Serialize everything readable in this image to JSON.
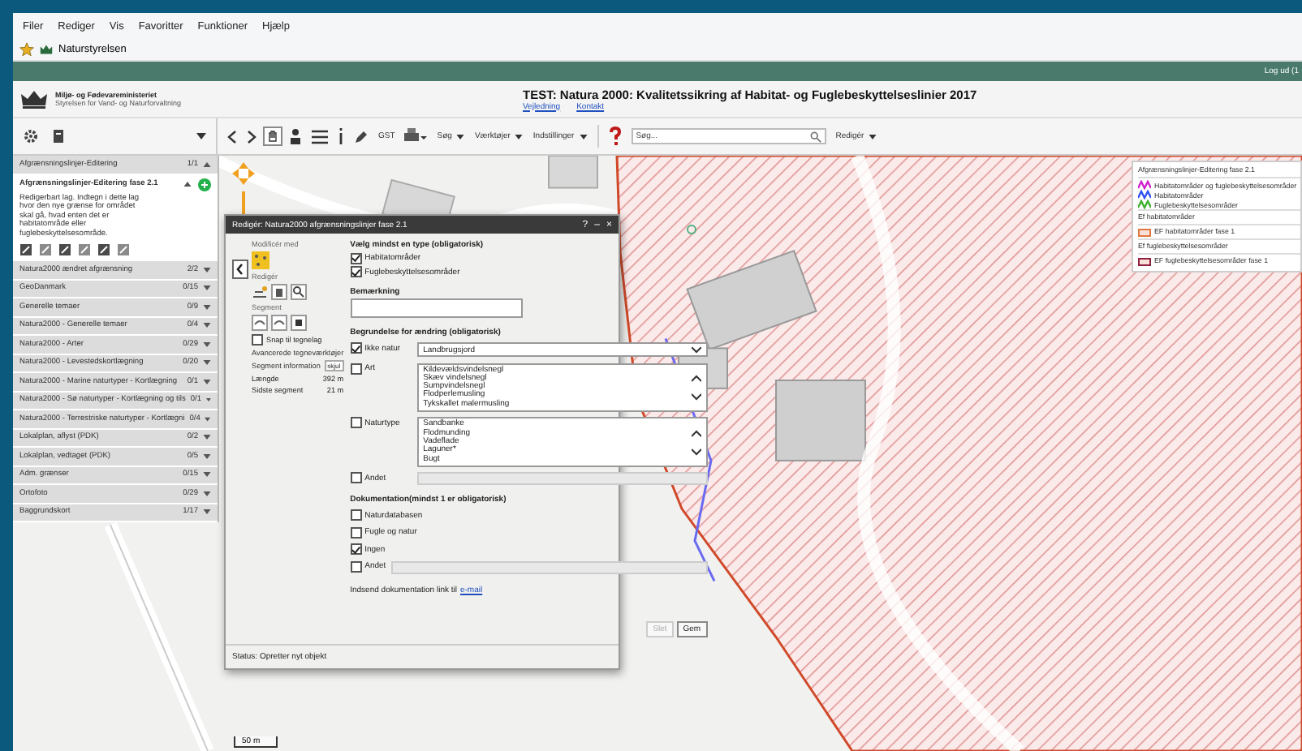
{
  "browser": {
    "menu": [
      "Filer",
      "Rediger",
      "Vis",
      "Favoritter",
      "Funktioner",
      "Hjælp"
    ],
    "favorite": "Naturstyrelsen"
  },
  "header": {
    "logout": "Log ud (1",
    "ministry": "Miljø- og Fødevareministeriet",
    "agency": "Styrelsen for Vand- og Naturforvaltning",
    "title": "TEST: Natura 2000: Kvalitetssikring af Habitat- og Fuglebeskyttelseslinier 2017",
    "links": [
      "Vejledning",
      "Kontakt"
    ]
  },
  "toolbar": {
    "menus": [
      "GST",
      "Søg",
      "Værktøjer",
      "Indstillinger"
    ],
    "search_placeholder": "Søg...",
    "edit_menu": "Redigér"
  },
  "layers": {
    "group": {
      "name": "Afgrænsningslinjer-Editering",
      "count": "1/1"
    },
    "active": {
      "name": "Afgrænsningslinjer-Editering fase 2.1",
      "description": "Redigerbart lag. Indtegn i dette lag hvor den nye grænse for området skal gå, hvad enten det er habitatområde eller fuglebeskyttelsesområde."
    },
    "groups": [
      {
        "name": "Natura2000 ændret afgrænsning",
        "count": "2/2"
      },
      {
        "name": "GeoDanmark",
        "count": "0/15"
      },
      {
        "name": "Generelle temaer",
        "count": "0/9"
      },
      {
        "name": "Natura2000 - Generelle temaer",
        "count": "0/4"
      },
      {
        "name": "Natura2000 - Arter",
        "count": "0/29"
      },
      {
        "name": "Natura2000 - Levestedskortlægning",
        "count": "0/20"
      },
      {
        "name": "Natura2000 - Marine naturtyper - Kortlægning",
        "count": "0/1"
      },
      {
        "name": "Natura2000 - Sø naturtyper - Kortlægning og tils",
        "count": "0/1"
      },
      {
        "name": "Natura2000 - Terrestriske naturtyper - Kortlægni",
        "count": "0/4"
      },
      {
        "name": "Lokalplan, aflyst (PDK)",
        "count": "0/2"
      },
      {
        "name": "Lokalplan, vedtaget (PDK)",
        "count": "0/5"
      },
      {
        "name": "Adm. grænser",
        "count": "0/15"
      },
      {
        "name": "Ortofoto",
        "count": "0/29"
      },
      {
        "name": "Baggrundskort",
        "count": "1/17"
      }
    ]
  },
  "dialog": {
    "title": "Redigér: Natura2000 afgrænsningslinjer fase 2.1",
    "controls": [
      "?",
      "–",
      "×"
    ],
    "modify_label": "Modificér med",
    "edit_label": "Redigér",
    "segment_label": "Segment",
    "snap": {
      "label": "Snap til tegnelag",
      "checked": false
    },
    "advanced": "Avancerede tegneværktøjer",
    "segment_info": "Segment information",
    "hide": "skjul",
    "measures": [
      {
        "label": "Længde",
        "value": "392 m"
      },
      {
        "label": "Sidste segment",
        "value": "21 m"
      }
    ],
    "type_heading": "Vælg mindst en type (obligatorisk)",
    "types": [
      {
        "label": "Habitatområder",
        "checked": true
      },
      {
        "label": "Fuglebeskyttelsesområder",
        "checked": true
      }
    ],
    "remark_label": "Bemærkning",
    "reason_heading": "Begrundelse for ændring (obligatorisk)",
    "reasons": [
      {
        "kind": "select",
        "label": "Ikke natur",
        "checked": true,
        "value": "Landbrugsjord"
      },
      {
        "kind": "list",
        "label": "Art",
        "checked": false,
        "options": [
          "Kildevældsvindelsnegl",
          "Skæv vindelsnegl",
          "Sumpvindelsnegl",
          "Flodperlemusling",
          "Tykskallet malermusling"
        ]
      },
      {
        "kind": "list",
        "label": "Naturtype",
        "checked": false,
        "options": [
          "Sandbanke",
          "Flodmunding",
          "Vadeflade",
          "Laguner*",
          "Bugt"
        ]
      },
      {
        "kind": "text",
        "label": "Andet",
        "checked": false
      }
    ],
    "doc_heading": "Dokumentation(mindst 1 er obligatorisk)",
    "docs": [
      {
        "kind": "check",
        "label": "Naturdatabasen",
        "checked": false
      },
      {
        "kind": "check",
        "label": "Fugle og natur",
        "checked": false
      },
      {
        "kind": "check",
        "label": "Ingen",
        "checked": true
      },
      {
        "kind": "text",
        "label": "Andet",
        "checked": false
      }
    ],
    "doc_link_text": "Indsend dokumentation link til",
    "doc_link": "e-mail",
    "buttons": [
      {
        "label": "Slet",
        "disabled": true
      },
      {
        "label": "Gem",
        "disabled": false
      }
    ],
    "status": "Status: Opretter nyt objekt"
  },
  "legend": {
    "title": "Afgrænsningslinjer-Editering fase 2.1",
    "items": [
      {
        "kind": "line",
        "label": "Habitatområder og fuglebeskyttelsesområder",
        "color": "#d020d0"
      },
      {
        "kind": "line",
        "label": "Habitatområder",
        "color": "#3050f0"
      },
      {
        "kind": "line",
        "label": "Fuglebeskyttelsesområder",
        "color": "#40b030"
      },
      {
        "kind": "heading",
        "label": "Ef habitatområder"
      },
      {
        "kind": "box",
        "label": "EF habitatområder fase 1",
        "color": "#e07840"
      },
      {
        "kind": "heading",
        "label": "Ef fuglebeskyttelsesområder"
      },
      {
        "kind": "box",
        "label": "EF fuglebeskyttelsesområder fase 1",
        "color": "#902040"
      }
    ]
  },
  "scale": "50 m"
}
